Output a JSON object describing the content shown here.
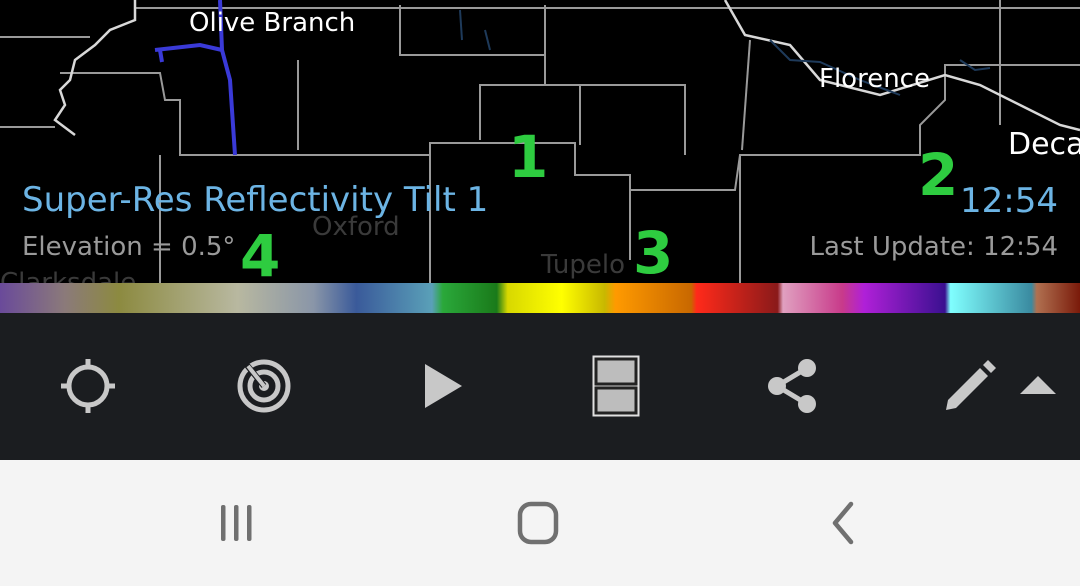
{
  "map": {
    "cities": [
      {
        "name": "Olive Branch"
      },
      {
        "name": "Florence"
      },
      {
        "name": "Deca"
      },
      {
        "name": "Oxford"
      },
      {
        "name": "Tupelo"
      },
      {
        "name": "Clarksdale"
      }
    ],
    "markers": [
      "1",
      "2",
      "3",
      "4"
    ]
  },
  "radar": {
    "product": "Super-Res Reflectivity Tilt 1",
    "elevation": "Elevation = 0.5°",
    "scan_time": "12:54",
    "last_update": "Last Update: 12:54"
  },
  "toolbar": {
    "buttons": [
      {
        "icon": "location-crosshair-icon"
      },
      {
        "icon": "radar-icon"
      },
      {
        "icon": "play-icon"
      },
      {
        "icon": "split-layout-icon"
      },
      {
        "icon": "share-icon"
      },
      {
        "icon": "pencil-icon"
      },
      {
        "icon": "expand-up-icon"
      }
    ]
  },
  "navbar": {
    "buttons": [
      {
        "icon": "recent-apps-icon"
      },
      {
        "icon": "home-icon"
      },
      {
        "icon": "back-icon"
      }
    ]
  },
  "colors": {
    "map_background": "#000000",
    "title_blue": "#6cb4e4",
    "marker_green": "#2ecc40",
    "toolbar_bg": "#1b1d20",
    "navbar_bg": "#f4f4f4",
    "icon_gray": "#c8c8c8"
  }
}
